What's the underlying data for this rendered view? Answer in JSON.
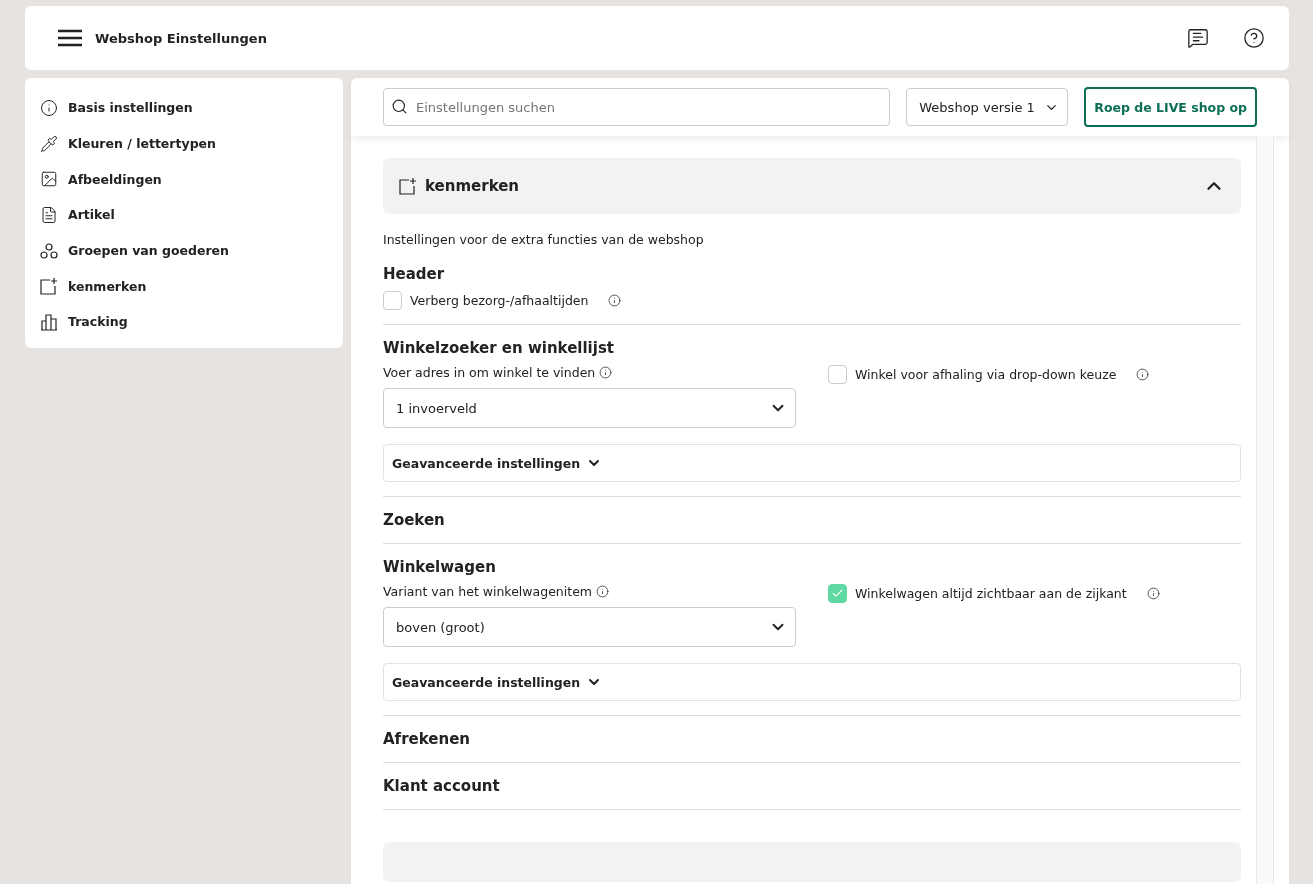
{
  "header": {
    "title": "Webshop Einstellungen"
  },
  "sidebar": {
    "items": [
      {
        "label": "Basis instellingen"
      },
      {
        "label": "Kleuren / lettertypen"
      },
      {
        "label": "Afbeeldingen"
      },
      {
        "label": "Artikel"
      },
      {
        "label": "Groepen van goederen"
      },
      {
        "label": "kenmerken"
      },
      {
        "label": "Tracking"
      }
    ]
  },
  "toolbar": {
    "search": {
      "placeholder": "Einstellungen suchen"
    },
    "version": {
      "value": "Webshop versie 1"
    },
    "live_button": "Roep de LIVE shop op"
  },
  "section": {
    "title": "kenmerken",
    "expanded": true,
    "description": "Instellingen voor de extra functies van de webshop",
    "subsections": [
      {
        "title": "Header",
        "fields": [
          {
            "kind": "checkbox",
            "label": "Verberg bezorg-/afhaaltijden",
            "checked": false
          }
        ]
      },
      {
        "title": "Winkelzoeker en winkellijst",
        "fields": [
          {
            "kind": "select",
            "label": "Voer adres in om winkel te vinden",
            "value": "1 invoerveld"
          },
          {
            "kind": "checkbox",
            "label": "Winkel voor afhaling via drop-down keuze",
            "checked": false
          }
        ],
        "advanced": {
          "label": "Geavanceerde instellingen",
          "expanded": false
        }
      },
      {
        "title": "Zoeken"
      },
      {
        "title": "Winkelwagen",
        "fields": [
          {
            "kind": "select",
            "label": "Variant van het winkelwagenitem",
            "value": "boven (groot)"
          },
          {
            "kind": "checkbox",
            "label": "Winkelwagen altijd zichtbaar aan de zijkant",
            "checked": true
          }
        ],
        "advanced": {
          "label": "Geavanceerde instellingen",
          "expanded": false
        }
      },
      {
        "title": "Afrekenen"
      },
      {
        "title": "Klant account"
      }
    ]
  }
}
